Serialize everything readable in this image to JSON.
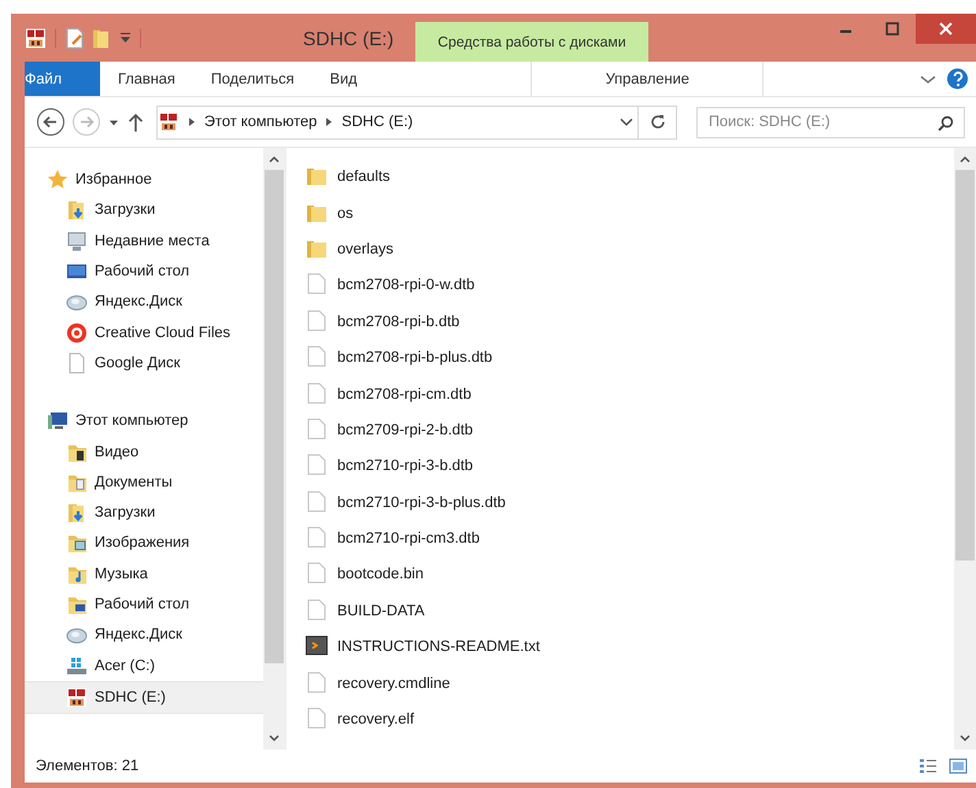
{
  "window": {
    "title": "SDHC (E:)",
    "tool_group": "Средства работы с дисками"
  },
  "ribbon_tabs": [
    {
      "label": "Файл",
      "kind": "file",
      "selected": false
    },
    {
      "label": "Главная",
      "kind": "tab",
      "selected": false
    },
    {
      "label": "Поделиться",
      "kind": "tab",
      "selected": false
    },
    {
      "label": "Вид",
      "kind": "tab",
      "selected": false
    },
    {
      "label": "Управление",
      "kind": "tool",
      "selected": false
    }
  ],
  "address": {
    "crumbs": [
      "Этот компьютер",
      "SDHC (E:)"
    ],
    "search_placeholder": "Поиск: SDHC (E:)"
  },
  "navigation": [
    {
      "label": "Избранное",
      "kind": "star",
      "selected": false,
      "children": [
        {
          "label": "Загрузки",
          "kind": "downloads",
          "selected": false
        },
        {
          "label": "Недавние места",
          "kind": "recent",
          "selected": false
        },
        {
          "label": "Рабочий стол",
          "kind": "desktop",
          "selected": false
        },
        {
          "label": "Яндекс.Диск",
          "kind": "cloud",
          "selected": false
        },
        {
          "label": "Creative Cloud Files",
          "kind": "cc",
          "selected": false
        },
        {
          "label": "Google Диск",
          "kind": "page",
          "selected": false
        }
      ]
    },
    {
      "label": "Этот компьютер",
      "kind": "computer",
      "selected": false,
      "children": [
        {
          "label": "Видео",
          "kind": "video",
          "selected": false
        },
        {
          "label": "Документы",
          "kind": "docs",
          "selected": false
        },
        {
          "label": "Загрузки",
          "kind": "downloads",
          "selected": false
        },
        {
          "label": "Изображения",
          "kind": "images",
          "selected": false
        },
        {
          "label": "Музыка",
          "kind": "music",
          "selected": false
        },
        {
          "label": "Рабочий стол",
          "kind": "desktopfolder",
          "selected": false
        },
        {
          "label": "Яндекс.Диск",
          "kind": "cloud",
          "selected": false
        },
        {
          "label": "Acer (C:)",
          "kind": "drive",
          "selected": false
        },
        {
          "label": "SDHC (E:)",
          "kind": "sd",
          "selected": true
        }
      ]
    }
  ],
  "files": [
    {
      "name": "defaults",
      "kind": "folder"
    },
    {
      "name": "os",
      "kind": "folder"
    },
    {
      "name": "overlays",
      "kind": "folder"
    },
    {
      "name": "bcm2708-rpi-0-w.dtb",
      "kind": "file"
    },
    {
      "name": "bcm2708-rpi-b.dtb",
      "kind": "file"
    },
    {
      "name": "bcm2708-rpi-b-plus.dtb",
      "kind": "file"
    },
    {
      "name": "bcm2708-rpi-cm.dtb",
      "kind": "file"
    },
    {
      "name": "bcm2709-rpi-2-b.dtb",
      "kind": "file"
    },
    {
      "name": "bcm2710-rpi-3-b.dtb",
      "kind": "file"
    },
    {
      "name": "bcm2710-rpi-3-b-plus.dtb",
      "kind": "file"
    },
    {
      "name": "bcm2710-rpi-cm3.dtb",
      "kind": "file"
    },
    {
      "name": "bootcode.bin",
      "kind": "file"
    },
    {
      "name": "BUILD-DATA",
      "kind": "file"
    },
    {
      "name": "INSTRUCTIONS-README.txt",
      "kind": "script"
    },
    {
      "name": "recovery.cmdline",
      "kind": "file"
    },
    {
      "name": "recovery.elf",
      "kind": "file"
    }
  ],
  "status_bar": {
    "item_count": "Элементов: 21"
  }
}
